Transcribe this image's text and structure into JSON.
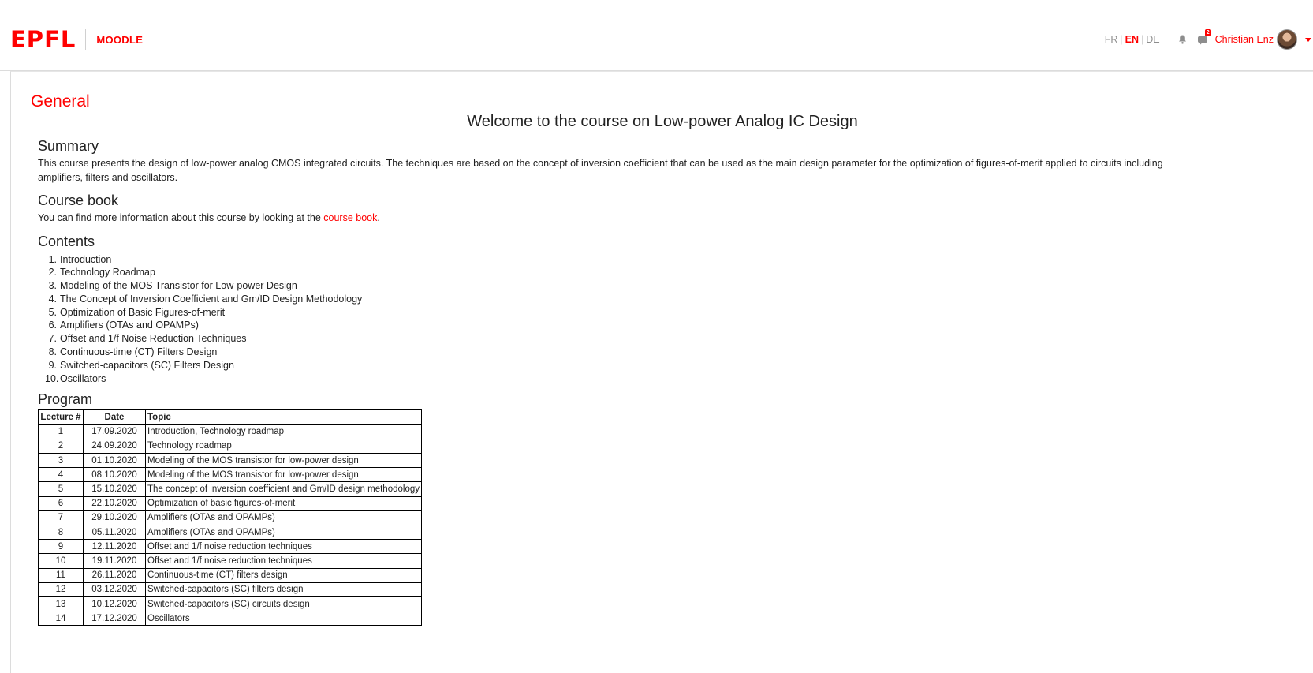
{
  "header": {
    "logo": "EPFL",
    "app_name": "MOODLE",
    "languages": [
      {
        "code": "FR",
        "active": false
      },
      {
        "code": "EN",
        "active": true
      },
      {
        "code": "DE",
        "active": false
      }
    ],
    "messages_badge": "2",
    "user_name": "Christian Enz",
    "icons": [
      "bell-icon",
      "chat-icon",
      "avatar",
      "caret-down-icon"
    ]
  },
  "section": {
    "title": "General",
    "welcome": "Welcome to the course on Low-power Analog IC Design"
  },
  "summary": {
    "heading": "Summary",
    "text": "This course presents the design of low-power analog CMOS integrated circuits. The techniques are based on the concept of inversion coefficient that can be used as the main design parameter for the optimization of figures-of-merit applied to circuits including amplifiers, filters and oscillators."
  },
  "course_book": {
    "heading": "Course book",
    "text_before": "You can find more information about this course by looking at the ",
    "link": "course book",
    "text_after": "."
  },
  "contents": {
    "heading": "Contents",
    "items": [
      {
        "num": "1.",
        "label": "Introduction"
      },
      {
        "num": "2.",
        "label": "Technology Roadmap"
      },
      {
        "num": "3.",
        "label": "Modeling of the MOS Transistor for Low-power Design"
      },
      {
        "num": "4.",
        "label": "The Concept of Inversion Coefficient and Gm/ID Design Methodology"
      },
      {
        "num": "5.",
        "label": "Optimization of Basic Figures-of-merit"
      },
      {
        "num": "6.",
        "label": "Amplifiers (OTAs and OPAMPs)"
      },
      {
        "num": "7.",
        "label": "Offset and 1/f Noise Reduction Techniques"
      },
      {
        "num": "8.",
        "label": "Continuous-time (CT) Filters Design"
      },
      {
        "num": "9.",
        "label": "Switched-capacitors (SC) Filters Design"
      },
      {
        "num": "10.",
        "label": "Oscillators"
      }
    ]
  },
  "program": {
    "heading": "Program",
    "columns": [
      "Lecture #",
      "Date",
      "Topic"
    ],
    "rows": [
      [
        "1",
        "17.09.2020",
        "Introduction, Technology roadmap"
      ],
      [
        "2",
        "24.09.2020",
        "Technology roadmap"
      ],
      [
        "3",
        "01.10.2020",
        "Modeling of the MOS transistor for low-power design"
      ],
      [
        "4",
        "08.10.2020",
        "Modeling of the MOS transistor for low-power design"
      ],
      [
        "5",
        "15.10.2020",
        "The concept of inversion coefficient and Gm/ID design methodology"
      ],
      [
        "6",
        "22.10.2020",
        "Optimization of basic figures-of-merit"
      ],
      [
        "7",
        "29.10.2020",
        "Amplifiers (OTAs and OPAMPs)"
      ],
      [
        "8",
        "05.11.2020",
        "Amplifiers (OTAs and OPAMPs)"
      ],
      [
        "9",
        "12.11.2020",
        "Offset and 1/f noise reduction techniques"
      ],
      [
        "10",
        "19.11.2020",
        "Offset and 1/f noise reduction techniques"
      ],
      [
        "11",
        "26.11.2020",
        "Continuous-time (CT) filters design"
      ],
      [
        "12",
        "03.12.2020",
        "Switched-capacitors (SC) filters design"
      ],
      [
        "13",
        "10.12.2020",
        "Switched-capacitors (SC) circuits design"
      ],
      [
        "14",
        "17.12.2020",
        "Oscillators"
      ]
    ]
  },
  "colors": {
    "accent": "#ff0000",
    "text": "#212121",
    "muted": "#8d8d8d"
  }
}
